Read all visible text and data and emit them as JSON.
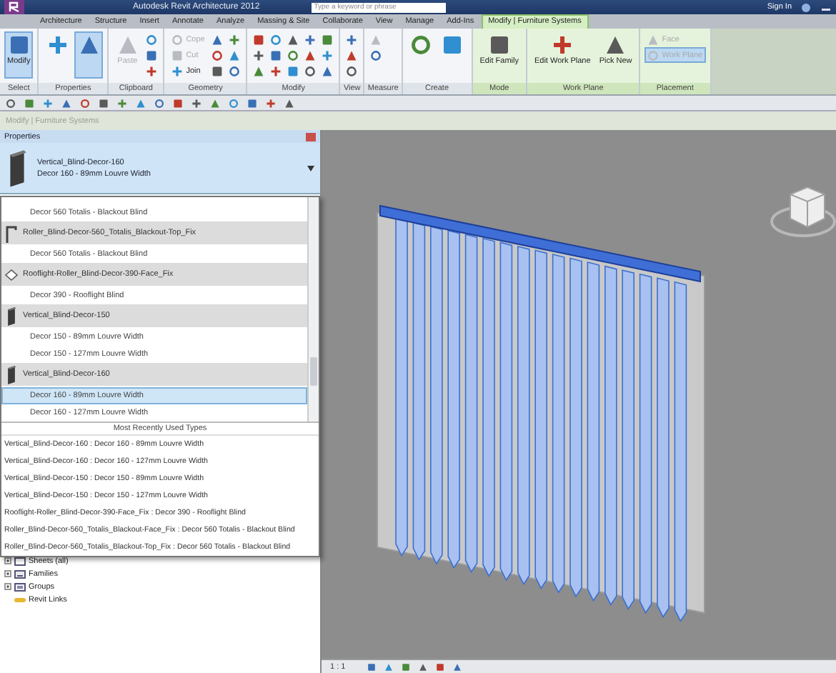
{
  "window": {
    "title": "Autodesk Revit Architecture 2012"
  },
  "search": {
    "placeholder": "Type a keyword or phrase"
  },
  "sign_in": "Sign In",
  "ribbon_tabs": [
    {
      "label": "Architecture",
      "selected": false
    },
    {
      "label": "Structure",
      "selected": false
    },
    {
      "label": "Insert",
      "selected": false
    },
    {
      "label": "Annotate",
      "selected": false
    },
    {
      "label": "Analyze",
      "selected": false
    },
    {
      "label": "Massing & Site",
      "selected": false
    },
    {
      "label": "Collaborate",
      "selected": false
    },
    {
      "label": "View",
      "selected": false
    },
    {
      "label": "Manage",
      "selected": false
    },
    {
      "label": "Add-Ins",
      "selected": false
    },
    {
      "label": "Modify | Furniture Systems",
      "selected": true
    }
  ],
  "ribbon_groups": [
    {
      "label": "Select",
      "contextual": false,
      "tools": [
        {
          "kind": "large",
          "label": "Modify",
          "selected": true,
          "disabled": false
        }
      ]
    },
    {
      "label": "Properties",
      "contextual": false,
      "tools": [
        {
          "kind": "large",
          "selected": false,
          "disabled": false
        },
        {
          "kind": "large",
          "selected": true,
          "disabled": false
        }
      ]
    },
    {
      "label": "Clipboard",
      "contextual": false,
      "tools": [
        {
          "kind": "large",
          "label": "Paste",
          "selected": false,
          "disabled": true
        },
        {
          "kind": "icon",
          "selected": false,
          "disabled": false
        },
        {
          "kind": "icon",
          "selected": false,
          "disabled": false
        },
        {
          "kind": "icon",
          "selected": false,
          "disabled": false
        }
      ]
    },
    {
      "label": "Geometry",
      "contextual": false,
      "tools": [
        {
          "kind": "small",
          "label": "Cope",
          "selected": false,
          "disabled": true
        },
        {
          "kind": "small",
          "label": "Cut",
          "selected": false,
          "disabled": true
        },
        {
          "kind": "small",
          "label": "Join",
          "selected": false,
          "disabled": false
        },
        {
          "kind": "icon",
          "selected": false,
          "disabled": false
        },
        {
          "kind": "icon",
          "selected": false,
          "disabled": false
        },
        {
          "kind": "icon",
          "selected": false,
          "disabled": false
        },
        {
          "kind": "icon",
          "selected": false,
          "disabled": false
        },
        {
          "kind": "icon",
          "selected": false,
          "disabled": false
        },
        {
          "kind": "icon",
          "selected": false,
          "disabled": false
        }
      ]
    },
    {
      "label": "Modify",
      "contextual": false,
      "tools": [
        {
          "kind": "icon",
          "selected": false,
          "disabled": false
        },
        {
          "kind": "icon",
          "selected": false,
          "disabled": false
        },
        {
          "kind": "icon",
          "selected": false,
          "disabled": false
        },
        {
          "kind": "icon",
          "selected": false,
          "disabled": false
        },
        {
          "kind": "icon",
          "selected": false,
          "disabled": false
        },
        {
          "kind": "icon",
          "selected": false,
          "disabled": false
        },
        {
          "kind": "icon",
          "selected": false,
          "disabled": false
        },
        {
          "kind": "icon",
          "selected": false,
          "disabled": false
        },
        {
          "kind": "icon",
          "selected": false,
          "disabled": false
        },
        {
          "kind": "icon",
          "selected": false,
          "disabled": false
        },
        {
          "kind": "icon",
          "selected": false,
          "disabled": false
        },
        {
          "kind": "icon",
          "selected": false,
          "disabled": false
        },
        {
          "kind": "icon",
          "selected": false,
          "disabled": false
        },
        {
          "kind": "icon",
          "selected": false,
          "disabled": false
        },
        {
          "kind": "icon",
          "selected": false,
          "disabled": false
        }
      ]
    },
    {
      "label": "View",
      "contextual": false,
      "tools": [
        {
          "kind": "icon",
          "selected": false,
          "disabled": false
        },
        {
          "kind": "icon",
          "selected": false,
          "disabled": false
        },
        {
          "kind": "icon",
          "selected": false,
          "disabled": false
        }
      ]
    },
    {
      "label": "Measure",
      "contextual": false,
      "tools": [
        {
          "kind": "icon",
          "selected": false,
          "disabled": true
        },
        {
          "kind": "icon",
          "selected": false,
          "disabled": false
        }
      ]
    },
    {
      "label": "Create",
      "contextual": false,
      "tools": [
        {
          "kind": "large",
          "selected": false,
          "disabled": false
        },
        {
          "kind": "large",
          "selected": false,
          "disabled": false
        }
      ]
    },
    {
      "label": "Mode",
      "contextual": true,
      "tools": [
        {
          "kind": "large",
          "label": "Edit Family",
          "selected": false,
          "disabled": false
        }
      ]
    },
    {
      "label": "Work Plane",
      "contextual": true,
      "tools": [
        {
          "kind": "large",
          "label": "Edit Work Plane",
          "selected": false,
          "disabled": false
        },
        {
          "kind": "large",
          "label": "Pick New",
          "selected": false,
          "disabled": false
        }
      ]
    },
    {
      "label": "Placement",
      "contextual": true,
      "tools": [
        {
          "kind": "small",
          "label": "Face",
          "selected": false,
          "disabled": true
        },
        {
          "kind": "small",
          "label": "Work Plane",
          "selected": true,
          "disabled": true
        }
      ]
    }
  ],
  "options_bar": {
    "label": "Modify | Furniture Systems"
  },
  "properties": {
    "title": "Properties",
    "family": "Vertical_Blind-Decor-160",
    "type": "Decor 160 - 89mm Louvre Width"
  },
  "type_list": [
    {
      "kind": "type",
      "label": "Decor 560 Totalis - Blackout Blind",
      "selected": false
    },
    {
      "kind": "roller_blind",
      "label": "Roller_Blind-Decor-560_Totalis_Blackout-Top_Fix",
      "selected": false
    },
    {
      "kind": "type",
      "label": "Decor 560 Totalis - Blackout Blind",
      "selected": false
    },
    {
      "kind": "rooflight",
      "label": "Rooflight-Roller_Blind-Decor-390-Face_Fix",
      "selected": false
    },
    {
      "kind": "type",
      "label": "Decor 390 - Rooflight Blind",
      "selected": false
    },
    {
      "kind": "vertical_blind",
      "label": "Vertical_Blind-Decor-150",
      "selected": false
    },
    {
      "kind": "type",
      "label": "Decor 150 - 89mm Louvre Width",
      "selected": false
    },
    {
      "kind": "type",
      "label": "Decor 150 - 127mm Louvre Width",
      "selected": false
    },
    {
      "kind": "vertical_blind",
      "label": "Vertical_Blind-Decor-160",
      "selected": false
    },
    {
      "kind": "type",
      "label": "Decor 160 - 89mm Louvre Width",
      "selected": true
    },
    {
      "kind": "type",
      "label": "Decor 160 - 127mm Louvre Width",
      "selected": false
    }
  ],
  "recent_header": "Most Recently Used Types",
  "recent_types": [
    "Vertical_Blind-Decor-160 : Decor 160 - 89mm Louvre Width",
    "Vertical_Blind-Decor-160 : Decor 160 - 127mm Louvre Width",
    "Vertical_Blind-Decor-150 : Decor 150 - 89mm Louvre Width",
    "Vertical_Blind-Decor-150 : Decor 150 - 127mm Louvre Width",
    "Rooflight-Roller_Blind-Decor-390-Face_Fix : Decor 390 - Rooflight Blind",
    "Roller_Blind-Decor-560_Totalis_Blackout-Face_Fix : Decor 560 Totalis - Blackout Blind",
    "Roller_Blind-Decor-560_Totalis_Blackout-Top_Fix : Decor 560 Totalis - Blackout Blind"
  ],
  "project_browser": [
    {
      "kind": "sheets",
      "label": "Sheets (all)",
      "expanded": false
    },
    {
      "kind": "families",
      "label": "Families",
      "expanded": false
    },
    {
      "kind": "groups",
      "label": "Groups",
      "expanded": false
    },
    {
      "kind": "links",
      "label": "Revit Links"
    }
  ],
  "status_bar": {
    "scale": "1 : 1"
  }
}
